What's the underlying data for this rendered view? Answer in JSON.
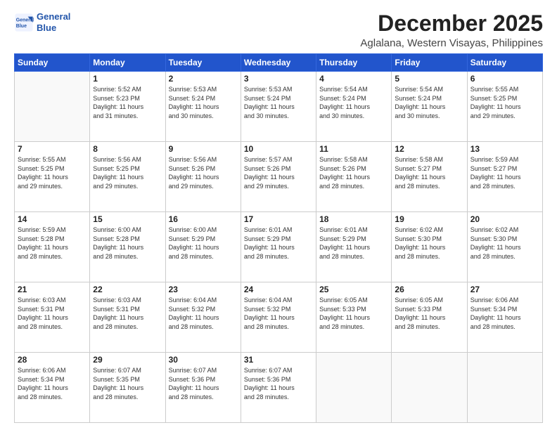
{
  "logo": {
    "line1": "General",
    "line2": "Blue"
  },
  "title": "December 2025",
  "location": "Aglalana, Western Visayas, Philippines",
  "days_of_week": [
    "Sunday",
    "Monday",
    "Tuesday",
    "Wednesday",
    "Thursday",
    "Friday",
    "Saturday"
  ],
  "weeks": [
    [
      {
        "day": "",
        "info": ""
      },
      {
        "day": "1",
        "info": "Sunrise: 5:52 AM\nSunset: 5:23 PM\nDaylight: 11 hours\nand 31 minutes."
      },
      {
        "day": "2",
        "info": "Sunrise: 5:53 AM\nSunset: 5:24 PM\nDaylight: 11 hours\nand 30 minutes."
      },
      {
        "day": "3",
        "info": "Sunrise: 5:53 AM\nSunset: 5:24 PM\nDaylight: 11 hours\nand 30 minutes."
      },
      {
        "day": "4",
        "info": "Sunrise: 5:54 AM\nSunset: 5:24 PM\nDaylight: 11 hours\nand 30 minutes."
      },
      {
        "day": "5",
        "info": "Sunrise: 5:54 AM\nSunset: 5:24 PM\nDaylight: 11 hours\nand 30 minutes."
      },
      {
        "day": "6",
        "info": "Sunrise: 5:55 AM\nSunset: 5:25 PM\nDaylight: 11 hours\nand 29 minutes."
      }
    ],
    [
      {
        "day": "7",
        "info": "Sunrise: 5:55 AM\nSunset: 5:25 PM\nDaylight: 11 hours\nand 29 minutes."
      },
      {
        "day": "8",
        "info": "Sunrise: 5:56 AM\nSunset: 5:25 PM\nDaylight: 11 hours\nand 29 minutes."
      },
      {
        "day": "9",
        "info": "Sunrise: 5:56 AM\nSunset: 5:26 PM\nDaylight: 11 hours\nand 29 minutes."
      },
      {
        "day": "10",
        "info": "Sunrise: 5:57 AM\nSunset: 5:26 PM\nDaylight: 11 hours\nand 29 minutes."
      },
      {
        "day": "11",
        "info": "Sunrise: 5:58 AM\nSunset: 5:26 PM\nDaylight: 11 hours\nand 28 minutes."
      },
      {
        "day": "12",
        "info": "Sunrise: 5:58 AM\nSunset: 5:27 PM\nDaylight: 11 hours\nand 28 minutes."
      },
      {
        "day": "13",
        "info": "Sunrise: 5:59 AM\nSunset: 5:27 PM\nDaylight: 11 hours\nand 28 minutes."
      }
    ],
    [
      {
        "day": "14",
        "info": "Sunrise: 5:59 AM\nSunset: 5:28 PM\nDaylight: 11 hours\nand 28 minutes."
      },
      {
        "day": "15",
        "info": "Sunrise: 6:00 AM\nSunset: 5:28 PM\nDaylight: 11 hours\nand 28 minutes."
      },
      {
        "day": "16",
        "info": "Sunrise: 6:00 AM\nSunset: 5:29 PM\nDaylight: 11 hours\nand 28 minutes."
      },
      {
        "day": "17",
        "info": "Sunrise: 6:01 AM\nSunset: 5:29 PM\nDaylight: 11 hours\nand 28 minutes."
      },
      {
        "day": "18",
        "info": "Sunrise: 6:01 AM\nSunset: 5:29 PM\nDaylight: 11 hours\nand 28 minutes."
      },
      {
        "day": "19",
        "info": "Sunrise: 6:02 AM\nSunset: 5:30 PM\nDaylight: 11 hours\nand 28 minutes."
      },
      {
        "day": "20",
        "info": "Sunrise: 6:02 AM\nSunset: 5:30 PM\nDaylight: 11 hours\nand 28 minutes."
      }
    ],
    [
      {
        "day": "21",
        "info": "Sunrise: 6:03 AM\nSunset: 5:31 PM\nDaylight: 11 hours\nand 28 minutes."
      },
      {
        "day": "22",
        "info": "Sunrise: 6:03 AM\nSunset: 5:31 PM\nDaylight: 11 hours\nand 28 minutes."
      },
      {
        "day": "23",
        "info": "Sunrise: 6:04 AM\nSunset: 5:32 PM\nDaylight: 11 hours\nand 28 minutes."
      },
      {
        "day": "24",
        "info": "Sunrise: 6:04 AM\nSunset: 5:32 PM\nDaylight: 11 hours\nand 28 minutes."
      },
      {
        "day": "25",
        "info": "Sunrise: 6:05 AM\nSunset: 5:33 PM\nDaylight: 11 hours\nand 28 minutes."
      },
      {
        "day": "26",
        "info": "Sunrise: 6:05 AM\nSunset: 5:33 PM\nDaylight: 11 hours\nand 28 minutes."
      },
      {
        "day": "27",
        "info": "Sunrise: 6:06 AM\nSunset: 5:34 PM\nDaylight: 11 hours\nand 28 minutes."
      }
    ],
    [
      {
        "day": "28",
        "info": "Sunrise: 6:06 AM\nSunset: 5:34 PM\nDaylight: 11 hours\nand 28 minutes."
      },
      {
        "day": "29",
        "info": "Sunrise: 6:07 AM\nSunset: 5:35 PM\nDaylight: 11 hours\nand 28 minutes."
      },
      {
        "day": "30",
        "info": "Sunrise: 6:07 AM\nSunset: 5:36 PM\nDaylight: 11 hours\nand 28 minutes."
      },
      {
        "day": "31",
        "info": "Sunrise: 6:07 AM\nSunset: 5:36 PM\nDaylight: 11 hours\nand 28 minutes."
      },
      {
        "day": "",
        "info": ""
      },
      {
        "day": "",
        "info": ""
      },
      {
        "day": "",
        "info": ""
      }
    ]
  ]
}
